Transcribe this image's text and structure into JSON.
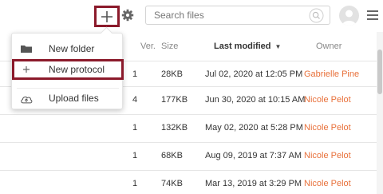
{
  "toolbar": {
    "add_icon": "plus-icon",
    "settings_icon": "gear-icon",
    "search_placeholder": "Search files",
    "search_icon": "search-icon",
    "avatar_icon": "user-avatar",
    "menu_icon": "hamburger-menu-icon",
    "highlight_color": "#8b1a2b"
  },
  "add_menu": {
    "items": [
      {
        "label": "New folder",
        "icon": "folder-icon"
      },
      {
        "label": "New protocol",
        "icon": "plus-icon",
        "highlighted": true
      },
      {
        "label": "Upload files",
        "icon": "cloud-upload-icon"
      }
    ]
  },
  "table": {
    "columns": {
      "version": "Ver.",
      "size": "Size",
      "last_modified": "Last modified",
      "owner": "Owner"
    },
    "sort": {
      "column": "last_modified",
      "direction": "descending"
    },
    "owner_color": "#e8703a",
    "rows": [
      {
        "version": "1",
        "size": "28KB",
        "modified": "Jul 02, 2020 at 12:05 PM",
        "owner": "Gabrielle Pine"
      },
      {
        "version": "4",
        "size": "177KB",
        "modified": "Jun 30, 2020 at 10:15 AM",
        "owner": "Nicole Pelot"
      },
      {
        "version": "1",
        "size": "132KB",
        "modified": "May 02, 2020 at 5:28 PM",
        "owner": "Nicole Pelot"
      },
      {
        "version": "1",
        "size": "68KB",
        "modified": "Aug 09, 2019 at 7:37 AM",
        "owner": "Nicole Pelot"
      },
      {
        "version": "1",
        "size": "74KB",
        "modified": "Mar 13, 2019 at 3:29 PM",
        "owner": "Nicole Pelot"
      }
    ]
  }
}
